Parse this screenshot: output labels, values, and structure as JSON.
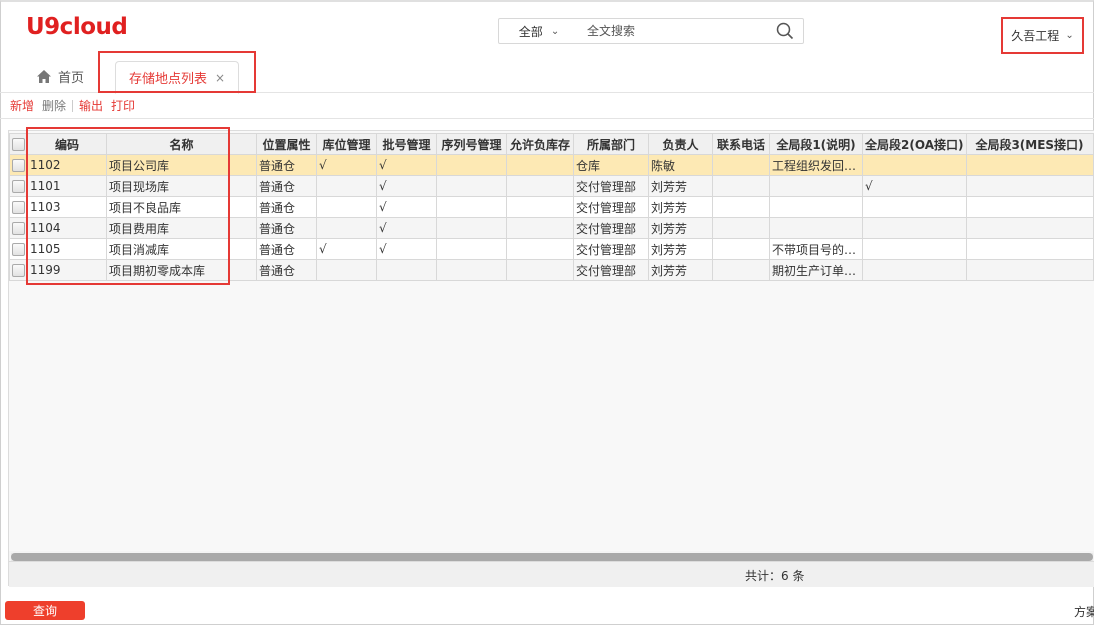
{
  "app": {
    "logo": "U9cloud"
  },
  "search": {
    "scope": "全部",
    "placeholder": "全文搜索"
  },
  "org": {
    "name": "久吾工程"
  },
  "tabs": {
    "home": "首页",
    "active": "存储地点列表",
    "close": "×"
  },
  "toolbar": {
    "add": "新增",
    "delete": "删除",
    "export": "输出",
    "print": "打印"
  },
  "grid": {
    "columns": [
      "编码",
      "名称",
      "位置属性",
      "库位管理",
      "批号管理",
      "序列号管理",
      "允许负库存",
      "所属部门",
      "负责人",
      "联系电话",
      "全局段1(说明)",
      "全局段2(OA接口)",
      "全局段3(MES接口)"
    ],
    "rows": [
      [
        "1102",
        "项目公司库",
        "普通仓",
        "√",
        "√",
        "",
        "",
        "仓库",
        "陈敏",
        "",
        "工程组织发回…",
        "",
        ""
      ],
      [
        "1101",
        "项目现场库",
        "普通仓",
        "",
        "√",
        "",
        "",
        "交付管理部",
        "刘芳芳",
        "",
        "",
        "√",
        ""
      ],
      [
        "1103",
        "项目不良品库",
        "普通仓",
        "",
        "√",
        "",
        "",
        "交付管理部",
        "刘芳芳",
        "",
        "",
        "",
        ""
      ],
      [
        "1104",
        "项目费用库",
        "普通仓",
        "",
        "√",
        "",
        "",
        "交付管理部",
        "刘芳芳",
        "",
        "",
        "",
        ""
      ],
      [
        "1105",
        "项目消减库",
        "普通仓",
        "√",
        "√",
        "",
        "",
        "交付管理部",
        "刘芳芳",
        "",
        "不带项目号的…",
        "",
        ""
      ],
      [
        "1199",
        "项目期初零成本库",
        "普通仓",
        "",
        "",
        "",
        "",
        "交付管理部",
        "刘芳芳",
        "",
        "期初生产订单…",
        "",
        ""
      ]
    ],
    "selected_row": 0,
    "total": "共计：6 条"
  },
  "footer": {
    "query": "查询",
    "plan": "方案"
  },
  "colors": {
    "accent": "#e53935",
    "selected_row": "#fde9b4"
  }
}
